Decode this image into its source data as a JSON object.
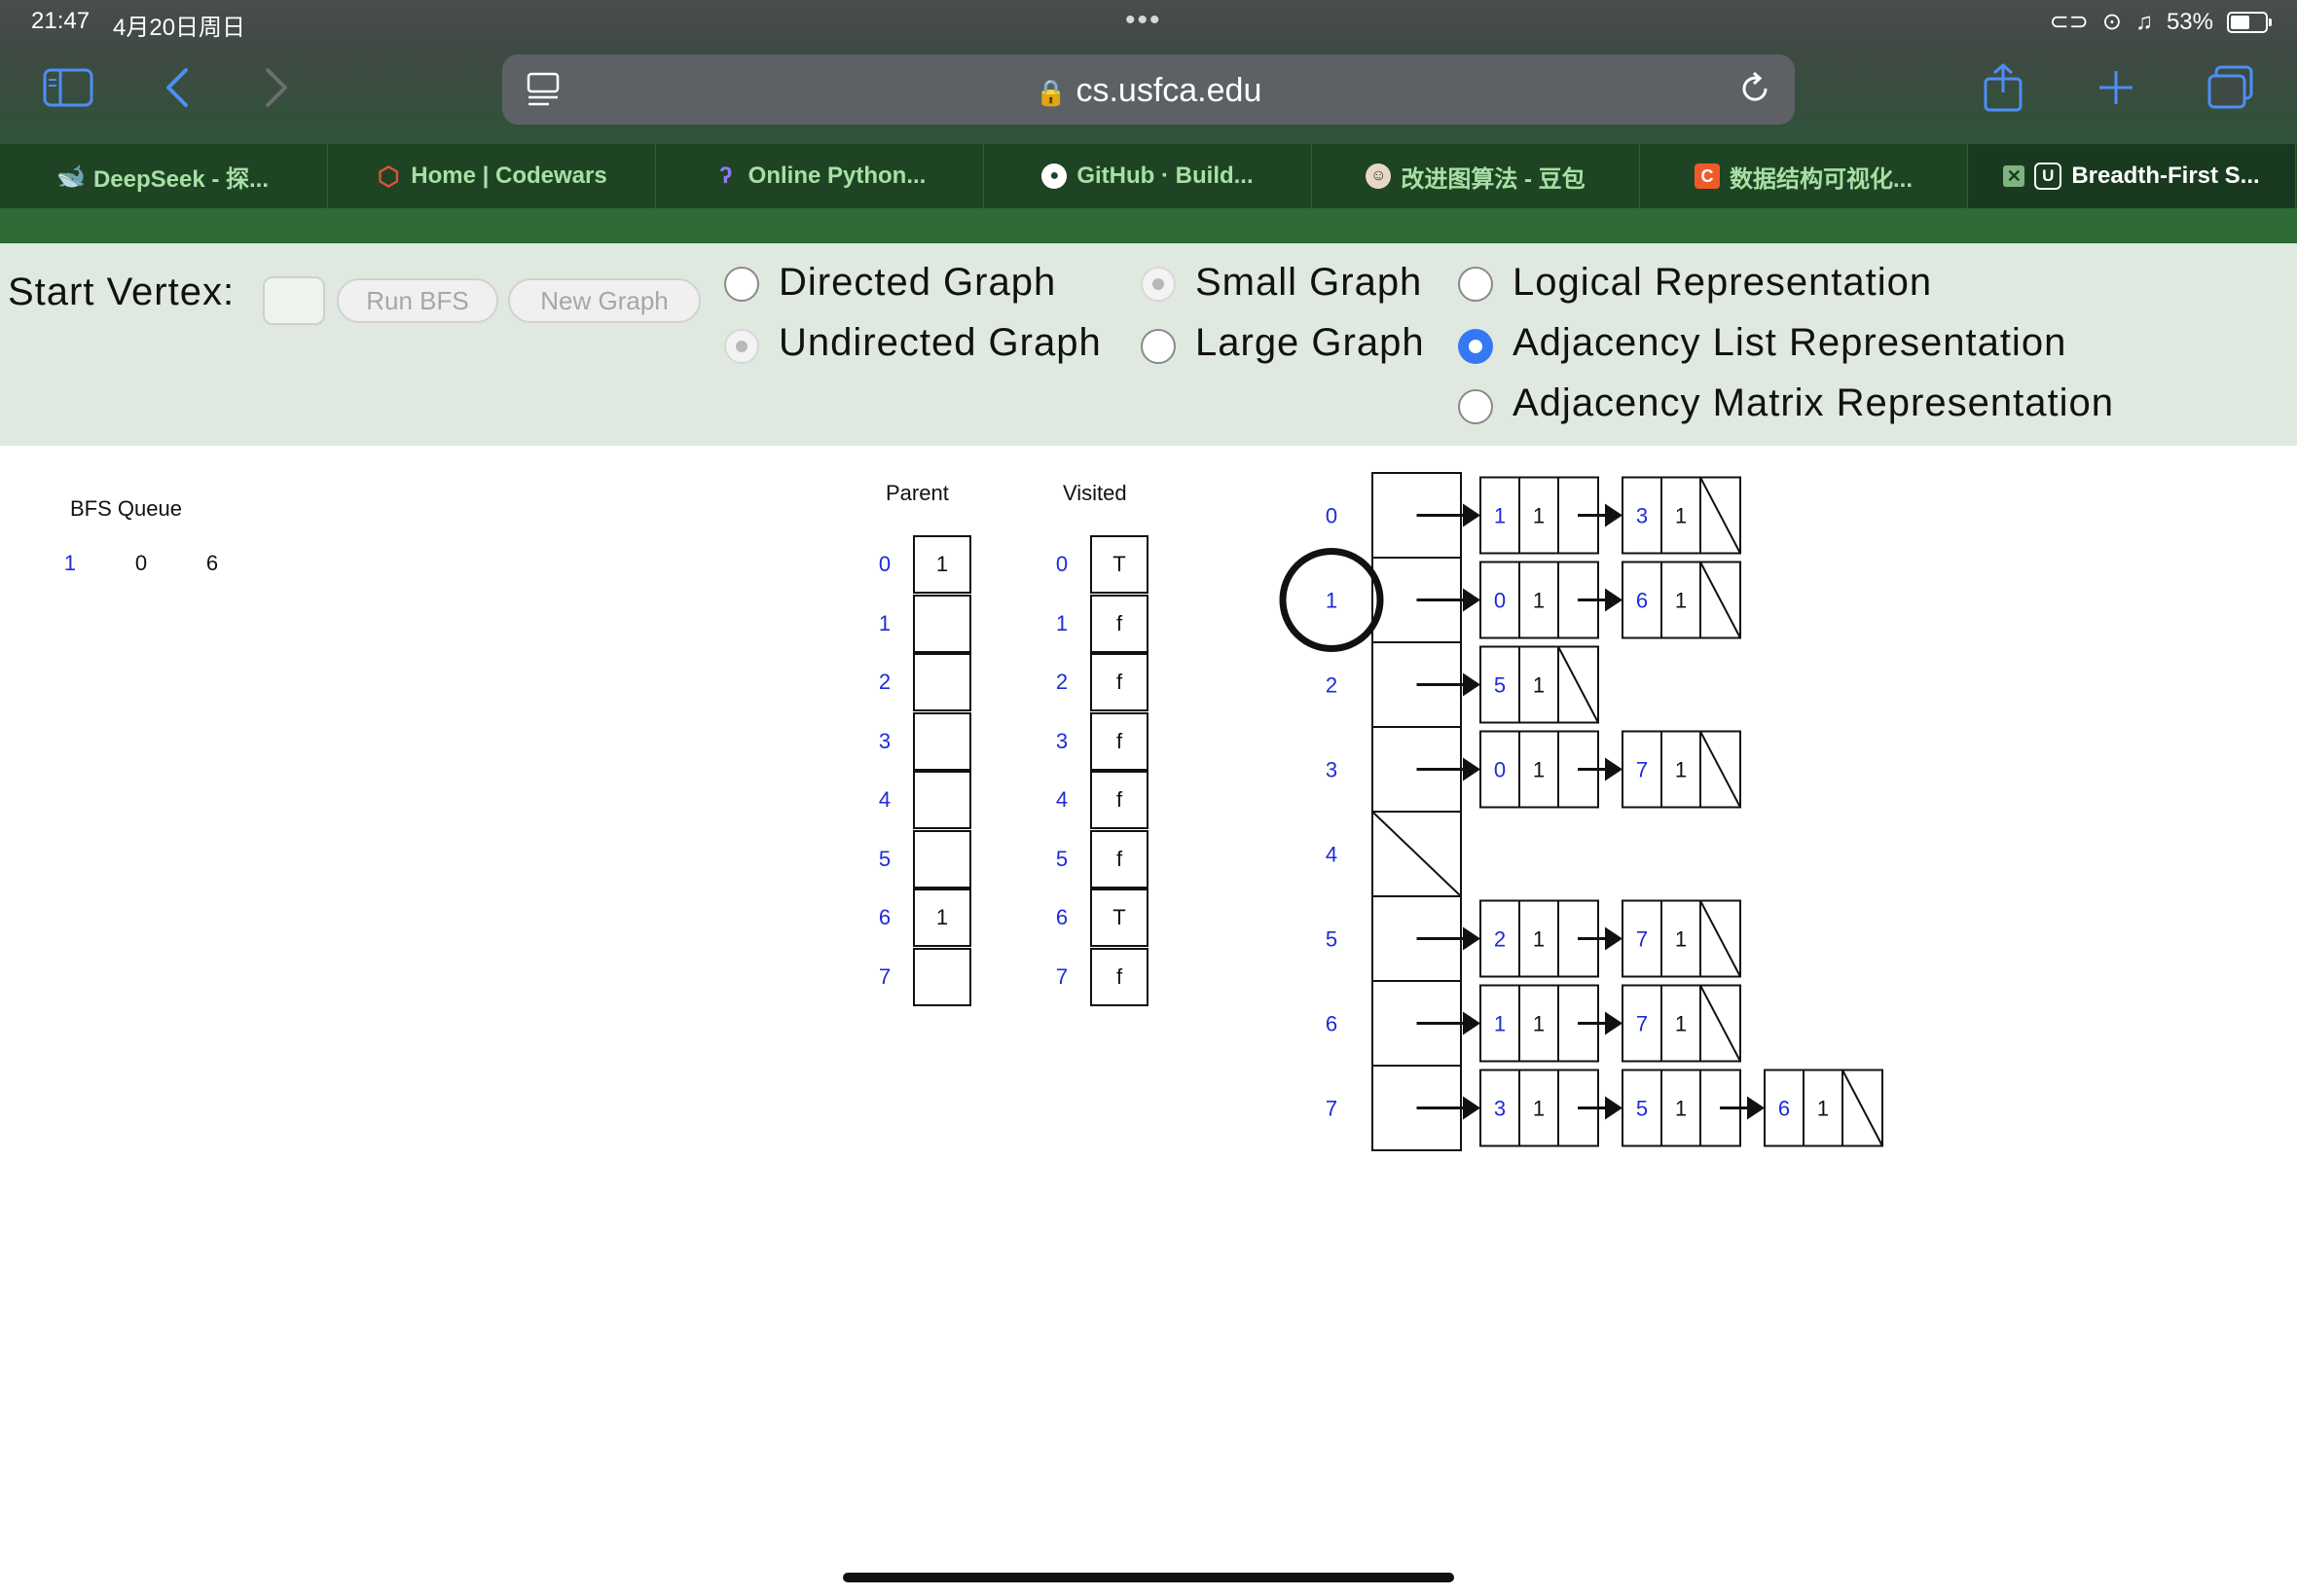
{
  "status": {
    "time": "21:47",
    "date": "4月20日周日",
    "battery": "53%"
  },
  "browser": {
    "url": "cs.usfca.edu"
  },
  "tabs": [
    {
      "label": "DeepSeek - 探...",
      "icon": "whale-icon",
      "color": "#4d6bfe"
    },
    {
      "label": "Home | Codewars",
      "icon": "codewars-icon",
      "color": "#b1361e"
    },
    {
      "label": "Online Python...",
      "icon": "python-icon",
      "color": "#7b61ff"
    },
    {
      "label": "GitHub · Build...",
      "icon": "github-icon",
      "color": "#ffffff"
    },
    {
      "label": "改进图算法 - 豆包",
      "icon": "doubao-icon",
      "color": "#e8d7c8"
    },
    {
      "label": "数据结构可视化...",
      "icon": "c-icon",
      "color": "#f05a28"
    },
    {
      "label": "Breadth-First S...",
      "icon": "u-icon",
      "color": "#ffffff"
    }
  ],
  "controls": {
    "start_vertex_label": "Start Vertex:",
    "start_vertex_value": "",
    "run_bfs": "Run BFS",
    "new_graph": "New Graph",
    "directed": "Directed Graph",
    "undirected": "Undirected Graph",
    "small": "Small Graph",
    "large": "Large Graph",
    "logical": "Logical Representation",
    "adj_list": "Adjacency List Representation",
    "adj_matrix": "Adjacency Matrix Representation",
    "selected_graph_type": "Undirected Graph",
    "selected_size": "Small Graph",
    "selected_representation": "Adjacency List Representation"
  },
  "bfs_queue": {
    "title": "BFS Queue",
    "items": [
      "1",
      "0",
      "6"
    ]
  },
  "parent": {
    "title": "Parent",
    "indices": [
      "0",
      "1",
      "2",
      "3",
      "4",
      "5",
      "6",
      "7"
    ],
    "values": [
      "1",
      "",
      "",
      "",
      "",
      "",
      "1",
      ""
    ]
  },
  "visited": {
    "title": "Visited",
    "indices": [
      "0",
      "1",
      "2",
      "3",
      "4",
      "5",
      "6",
      "7"
    ],
    "values": [
      "T",
      "f",
      "f",
      "f",
      "f",
      "f",
      "T",
      "f"
    ]
  },
  "adjacency": {
    "current_vertex": "1",
    "vertices": [
      {
        "id": "0",
        "edges": [
          {
            "to": "1",
            "w": "1"
          },
          {
            "to": "3",
            "w": "1"
          }
        ]
      },
      {
        "id": "1",
        "edges": [
          {
            "to": "0",
            "w": "1"
          },
          {
            "to": "6",
            "w": "1"
          }
        ]
      },
      {
        "id": "2",
        "edges": [
          {
            "to": "5",
            "w": "1"
          }
        ]
      },
      {
        "id": "3",
        "edges": [
          {
            "to": "0",
            "w": "1"
          },
          {
            "to": "7",
            "w": "1"
          }
        ]
      },
      {
        "id": "4",
        "edges": []
      },
      {
        "id": "5",
        "edges": [
          {
            "to": "2",
            "w": "1"
          },
          {
            "to": "7",
            "w": "1"
          }
        ]
      },
      {
        "id": "6",
        "edges": [
          {
            "to": "1",
            "w": "1"
          },
          {
            "to": "7",
            "w": "1"
          }
        ]
      },
      {
        "id": "7",
        "edges": [
          {
            "to": "3",
            "w": "1"
          },
          {
            "to": "5",
            "w": "1"
          },
          {
            "to": "6",
            "w": "1"
          }
        ]
      }
    ]
  }
}
